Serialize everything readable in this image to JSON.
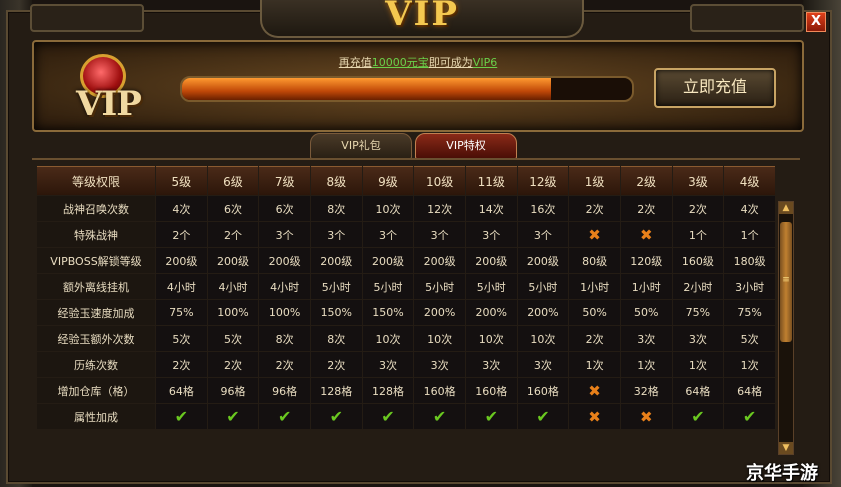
{
  "window": {
    "title": "VIP",
    "close_label": "X"
  },
  "banner": {
    "logo_text": "VIP",
    "tip_prefix": "再充值",
    "tip_amount": "10000元宝",
    "tip_middle": "即可成为",
    "tip_target": "VIP6",
    "progress_fraction": 0.82,
    "recharge_button": "立即充值"
  },
  "tabs": [
    {
      "label": "VIP礼包",
      "active": false
    },
    {
      "label": "VIP特权",
      "active": true
    }
  ],
  "table": {
    "header_label": "等级权限",
    "columns": [
      "5级",
      "6级",
      "7级",
      "8级",
      "9级",
      "10级",
      "11级",
      "12级",
      "1级",
      "2级",
      "3级",
      "4级"
    ],
    "rows": [
      {
        "label": "战神召唤次数",
        "cells": [
          "4次",
          "6次",
          "6次",
          "8次",
          "10次",
          "12次",
          "14次",
          "16次",
          "2次",
          "2次",
          "2次",
          "4次"
        ]
      },
      {
        "label": "特殊战神",
        "cells": [
          "2个",
          "2个",
          "3个",
          "3个",
          "3个",
          "3个",
          "3个",
          "3个",
          "x",
          "x",
          "1个",
          "1个"
        ]
      },
      {
        "label": "VIPBOSS解锁等级",
        "cells": [
          "200级",
          "200级",
          "200级",
          "200级",
          "200级",
          "200级",
          "200级",
          "200级",
          "80级",
          "120级",
          "160级",
          "180级"
        ]
      },
      {
        "label": "额外离线挂机",
        "cells": [
          "4小时",
          "4小时",
          "4小时",
          "5小时",
          "5小时",
          "5小时",
          "5小时",
          "5小时",
          "1小时",
          "1小时",
          "2小时",
          "3小时"
        ]
      },
      {
        "label": "经验玉速度加成",
        "cells": [
          "75%",
          "100%",
          "100%",
          "150%",
          "150%",
          "200%",
          "200%",
          "200%",
          "50%",
          "50%",
          "75%",
          "75%"
        ]
      },
      {
        "label": "经验玉额外次数",
        "cells": [
          "5次",
          "5次",
          "8次",
          "8次",
          "10次",
          "10次",
          "10次",
          "10次",
          "2次",
          "3次",
          "3次",
          "5次"
        ]
      },
      {
        "label": "历练次数",
        "cells": [
          "2次",
          "2次",
          "2次",
          "2次",
          "3次",
          "3次",
          "3次",
          "3次",
          "1次",
          "1次",
          "1次",
          "1次"
        ]
      },
      {
        "label": "增加仓库（格）",
        "cells": [
          "64格",
          "96格",
          "96格",
          "128格",
          "128格",
          "160格",
          "160格",
          "160格",
          "x",
          "32格",
          "64格",
          "64格"
        ]
      },
      {
        "label": "属性加成",
        "cells": [
          "v",
          "v",
          "v",
          "v",
          "v",
          "v",
          "v",
          "v",
          "x",
          "x",
          "v",
          "v"
        ]
      }
    ]
  },
  "scrollbar": {
    "up_label": "▲",
    "down_label": "▼",
    "grip": "≡"
  },
  "watermark": "京华手游",
  "colors": {
    "gold_title": "#f4c850",
    "check_green": "#6ac820",
    "cross_orange": "#e8801a",
    "highlight_green": "#6ad04a"
  }
}
